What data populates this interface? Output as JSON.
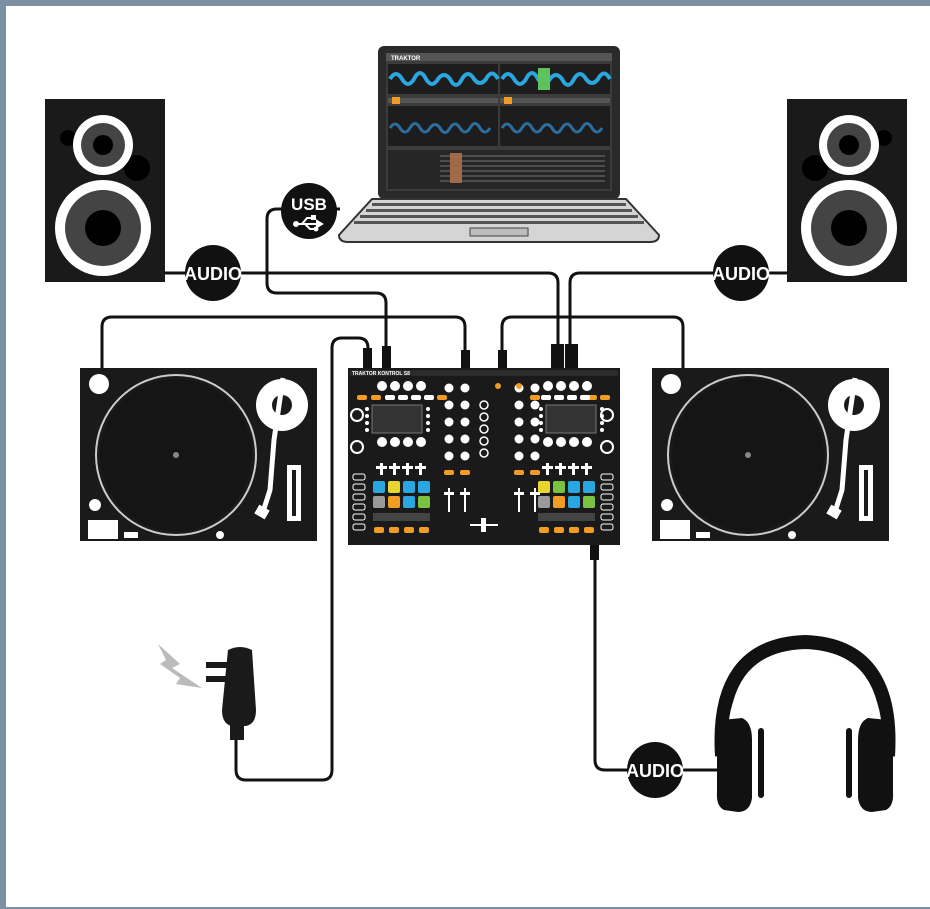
{
  "diagram": {
    "connections": {
      "audio_left_label": "AUDIO",
      "audio_right_label": "AUDIO",
      "usb_label": "USB",
      "audio_headphones_label": "AUDIO"
    },
    "laptop": {
      "app_name": "TRAKTOR"
    },
    "controller": {
      "model_name": "TRAKTOR KONTROL S8"
    }
  },
  "colors": {
    "frame": "#7d90a3",
    "device_dark": "#1a1a1a",
    "accent_orange": "#f39c23",
    "pad_blue": "#2aa7e0",
    "pad_yellow": "#e8d630",
    "pad_green": "#7cc242",
    "cable": "#111111"
  },
  "icons": [
    "usb-icon",
    "power-bolt-icon",
    "speaker-icon",
    "turntable-icon",
    "headphones-icon",
    "power-adapter-icon"
  ]
}
